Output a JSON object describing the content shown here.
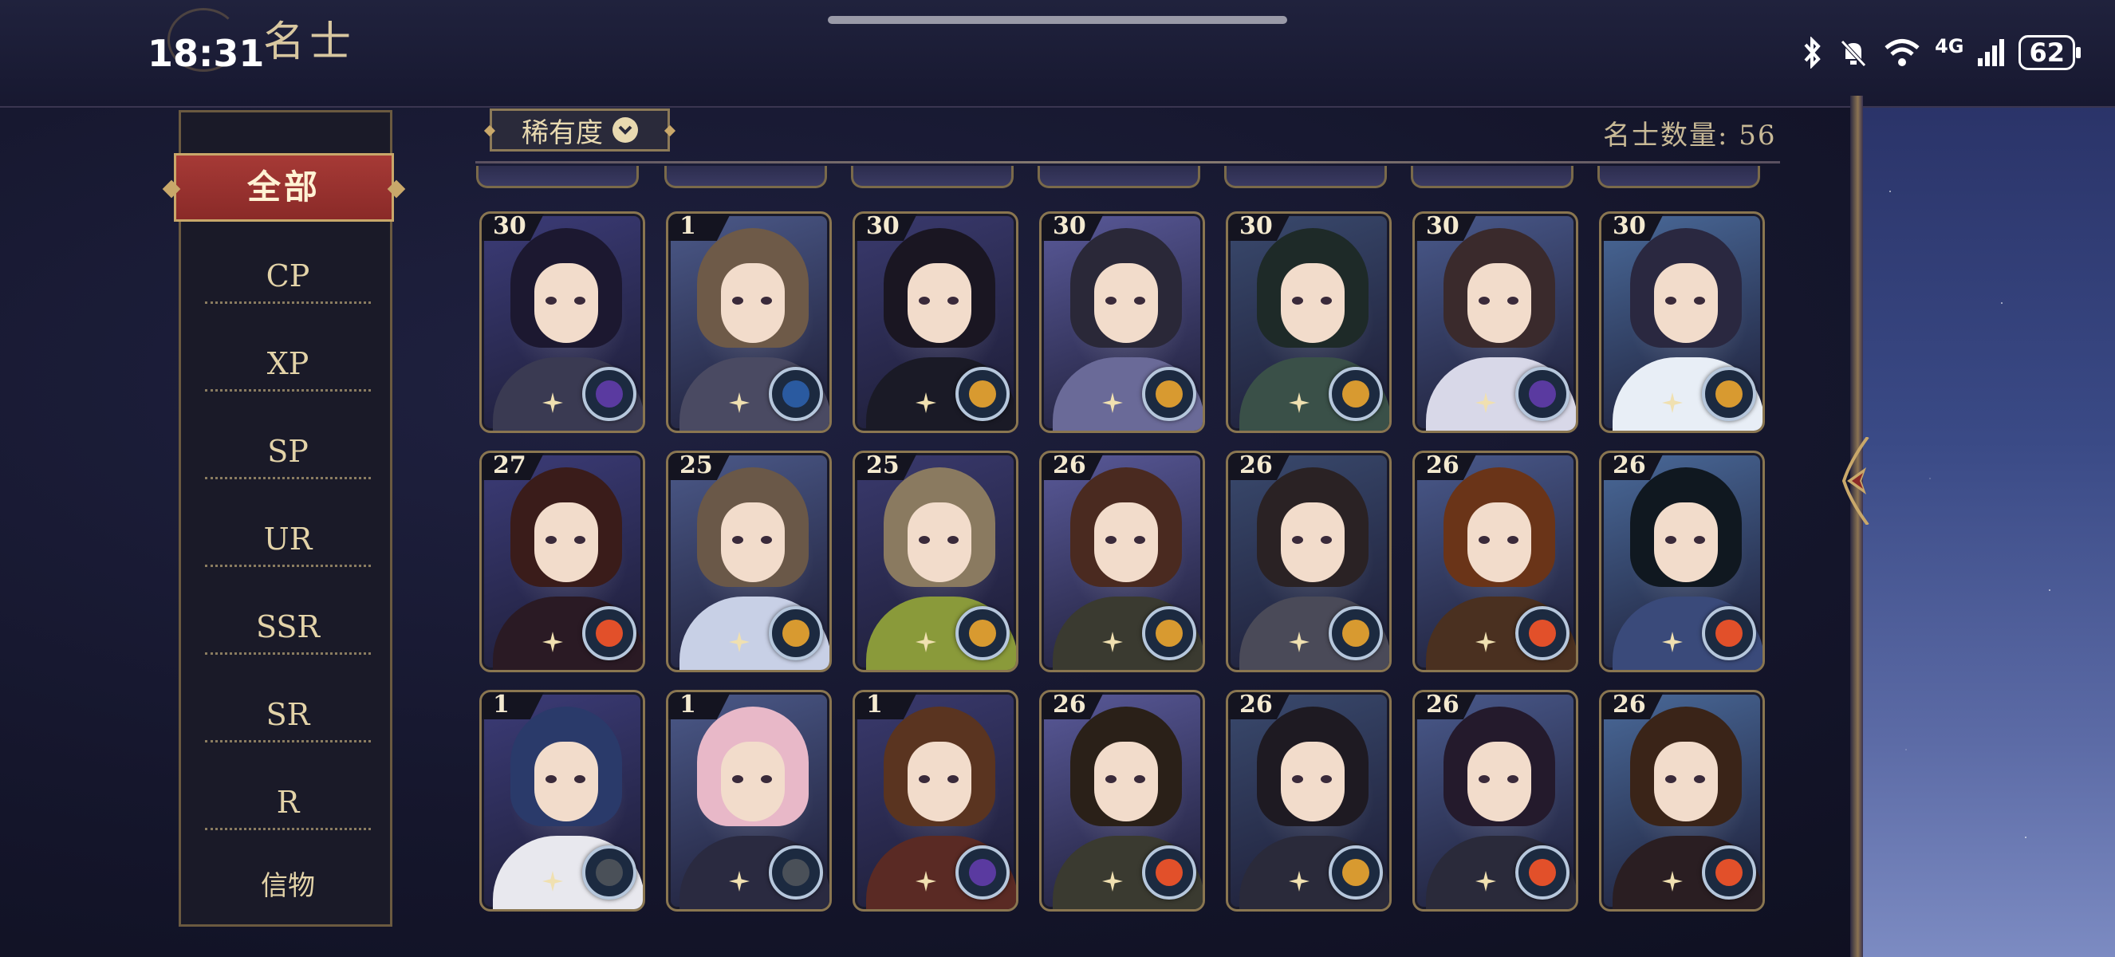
{
  "status_bar": {
    "time": "18:31",
    "network": "4G",
    "battery": "62"
  },
  "header": {
    "title": "名士"
  },
  "sidebar": {
    "active": "全部",
    "items": [
      {
        "label": "CP"
      },
      {
        "label": "XP"
      },
      {
        "label": "SP"
      },
      {
        "label": "UR"
      },
      {
        "label": "SSR"
      },
      {
        "label": "SR"
      },
      {
        "label": "R"
      },
      {
        "label": "信物"
      }
    ]
  },
  "toolbar": {
    "sort_label": "稀有度",
    "count_label": "名士数量: 56"
  },
  "colors": {
    "accent_red": "#8a2a28",
    "gold_border": "#8a7650",
    "panel_bg": "#15162c"
  },
  "cards": [
    {
      "level": "30",
      "element": "purple-moon-badge"
    },
    {
      "level": "1",
      "element": "blue-eye-badge"
    },
    {
      "level": "30",
      "element": "gold-moon-badge"
    },
    {
      "level": "30",
      "element": "gold-moon-badge"
    },
    {
      "level": "30",
      "element": "gold-moon-badge"
    },
    {
      "level": "30",
      "element": "purple-moon-badge"
    },
    {
      "level": "30",
      "element": "gold-moon-badge"
    },
    {
      "level": "27",
      "element": "red-sun-badge"
    },
    {
      "level": "25",
      "element": "gold-moon-badge"
    },
    {
      "level": "25",
      "element": "gold-moon-badge"
    },
    {
      "level": "26",
      "element": "gold-moon-badge"
    },
    {
      "level": "26",
      "element": "gold-moon-badge"
    },
    {
      "level": "26",
      "element": "red-sun-badge"
    },
    {
      "level": "26",
      "element": "red-sun-badge"
    },
    {
      "level": "1",
      "element": "grey-compass-badge"
    },
    {
      "level": "1",
      "element": "grey-compass-badge"
    },
    {
      "level": "1",
      "element": "purple-moon-badge"
    },
    {
      "level": "26",
      "element": "red-sun-badge"
    },
    {
      "level": "26",
      "element": "gold-moon-badge"
    },
    {
      "level": "26",
      "element": "red-sun-badge"
    },
    {
      "level": "26",
      "element": "red-sun-badge"
    }
  ]
}
